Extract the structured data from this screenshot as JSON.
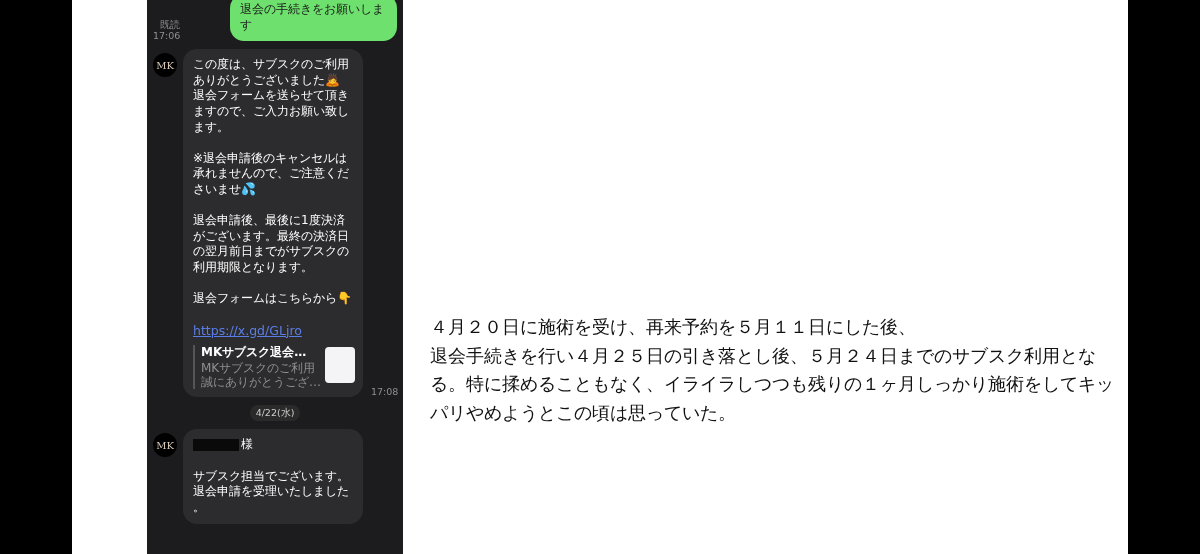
{
  "chat": {
    "messages": [
      {
        "kind": "sent",
        "paragraphs": [
          "退会の手続きをお願いします"
        ],
        "read_label": "既読",
        "time": "17:06"
      },
      {
        "kind": "received",
        "avatar": "MK",
        "paragraphs": [
          [
            "この度は、サブスクのご利用ありがとうございました🙇",
            "退会フォームを送らせて頂きますので、ご入力お願い致します。"
          ],
          "※退会申請後のキャンセルは承れませんので、ご注意くださいませ💦",
          "退会申請後、最後に1度決済がございます。最終の決済日の翌月前日までがサブスクの利用期限となります。",
          "退会フォームはこちらから👇"
        ],
        "link": "https://x.gd/GLjro",
        "preview": {
          "title": "MKサブスク退会…",
          "description_lines": [
            "MKサブスクのご利用",
            "誠にありがとうござ…"
          ]
        },
        "time": "17:08"
      },
      {
        "kind": "date",
        "text": "4/22(水)"
      },
      {
        "kind": "received",
        "avatar": "MK",
        "redacted_name": true,
        "name_suffix": "様",
        "paragraphs": [
          "サブスク担当でございます。退会申請を受理いたしました。"
        ]
      }
    ]
  },
  "article": {
    "lines": [
      "４月２０日に施術を受け、再来予約を５月１１日にした後、",
      "退会手続きを行い４月２５日の引き落とし後、５月２４日までのサブスク利用とな",
      "る。特に揉めることもなく、イライラしつつも残りの１ヶ月しっかり施術をしてキッ",
      "パリやめようとこの頃は思っていた。"
    ]
  }
}
